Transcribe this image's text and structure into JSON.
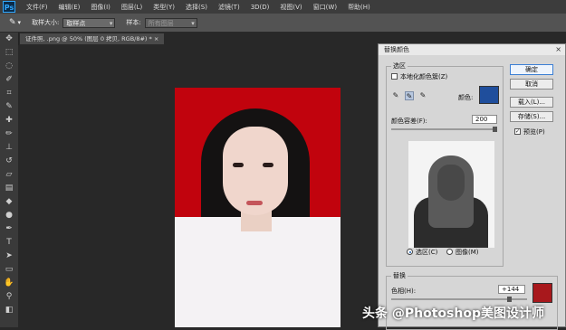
{
  "app": {
    "logo": "Ps"
  },
  "menu": [
    "文件(F)",
    "编辑(E)",
    "图像(I)",
    "图层(L)",
    "类型(Y)",
    "选择(S)",
    "滤镜(T)",
    "3D(D)",
    "视图(V)",
    "窗口(W)",
    "帮助(H)"
  ],
  "options": {
    "sample_size_label": "取样大小:",
    "sample_size_value": "取样点",
    "sample_label": "样本:",
    "sample_value": "所有图层"
  },
  "document": {
    "tab_title": "证件照, .png @ 50% (图层 0 拷贝, RGB/8#) * ×"
  },
  "dialog": {
    "title": "替换颜色",
    "close": "×",
    "selection_group": "选区",
    "localized_label": "本地化颜色簇(Z)",
    "color_label": "颜色:",
    "fuzziness_label": "颜色容差(F):",
    "fuzziness_value": "200",
    "radio_selection": "选区(C)",
    "radio_image": "图像(M)",
    "replace_group": "替换",
    "hue_label": "色相(H):",
    "hue_value": "+144",
    "buttons": {
      "ok": "确定",
      "cancel": "取消",
      "load": "载入(L)...",
      "save": "存储(S)...",
      "preview": "预览(P)"
    },
    "selected_color": "#1f4e9c",
    "result_color": "#a8181c"
  },
  "watermark": "头条 @Photoshop美图设计师"
}
